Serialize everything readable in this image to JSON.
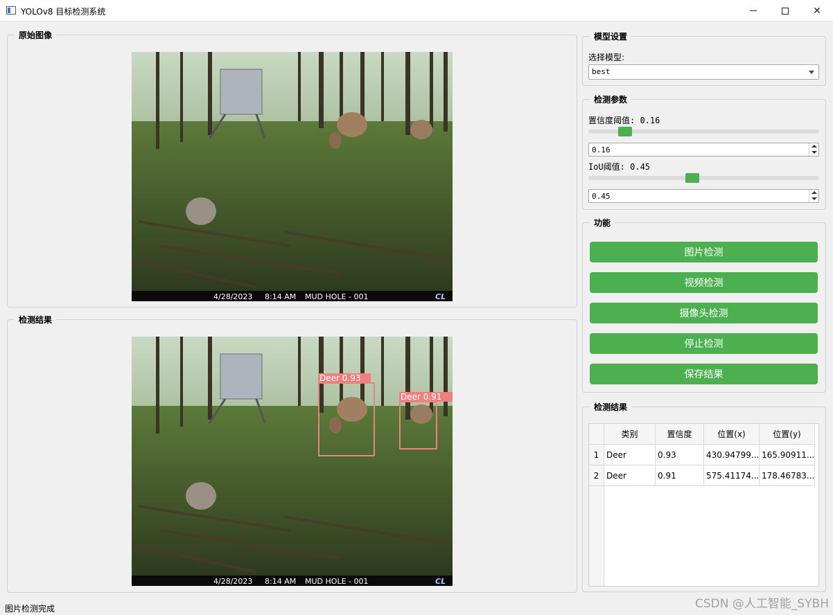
{
  "window": {
    "title": "YOLOv8 目标检测系统"
  },
  "original_panel": {
    "title": "原始图像"
  },
  "result_panel": {
    "title": "检测结果"
  },
  "camera_overlay": {
    "date": "4/28/2023",
    "time": "8:14 AM",
    "location": "MUD HOLE - 001",
    "brand": "CL"
  },
  "detections_overlay": [
    {
      "label": "Deer 0.93"
    },
    {
      "label": "Deer 0.91"
    }
  ],
  "model_settings": {
    "title": "模型设置",
    "select_label": "选择模型:",
    "selected_model": "best"
  },
  "detection_params": {
    "title": "检测参数",
    "confidence_label": "置信度阈值: 0.16",
    "confidence_value": "0.16",
    "confidence_fraction": 0.16,
    "iou_label": "IoU阈值: 0.45",
    "iou_value": "0.45",
    "iou_fraction": 0.45
  },
  "functions": {
    "title": "功能",
    "image_detect": "图片检测",
    "video_detect": "视频检测",
    "camera_detect": "摄像头检测",
    "stop_detect": "停止检测",
    "save_results": "保存结果"
  },
  "results_table": {
    "title": "检测结果",
    "headers": [
      "类别",
      "置信度",
      "位置(x)",
      "位置(y)"
    ],
    "rows": [
      {
        "index": "1",
        "class": "Deer",
        "confidence": "0.93",
        "x": "430.94799...",
        "y": "165.90911..."
      },
      {
        "index": "2",
        "class": "Deer",
        "confidence": "0.91",
        "x": "575.41174...",
        "y": "178.46783..."
      }
    ]
  },
  "status": {
    "text": "图片检测完成"
  },
  "watermark": "CSDN @人工智能_SYBH",
  "colors": {
    "accent": "#4caf50",
    "box": "#f08080"
  }
}
